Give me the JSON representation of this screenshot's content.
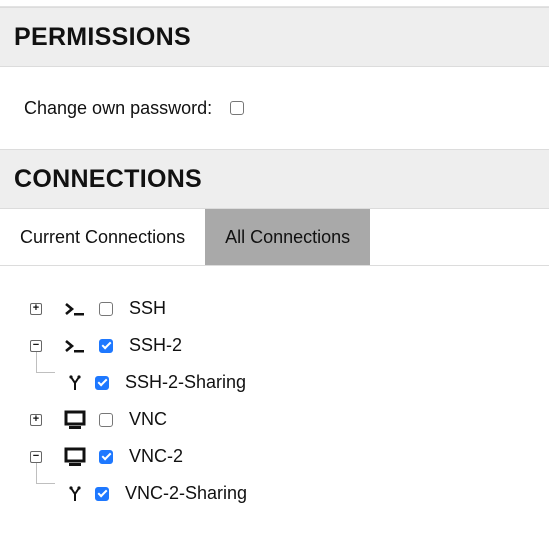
{
  "permissions": {
    "title": "PERMISSIONS",
    "change_password_label": "Change own password:",
    "change_password_checked": false
  },
  "connections": {
    "title": "CONNECTIONS",
    "tabs": [
      {
        "label": "Current Connections",
        "active": false
      },
      {
        "label": "All Connections",
        "active": true
      }
    ],
    "tree": [
      {
        "label": "SSH",
        "icon": "terminal-icon",
        "expander": "plus-expand-icon",
        "checked": false
      },
      {
        "label": "SSH-2",
        "icon": "terminal-icon",
        "expander": "minus-collapse-icon",
        "checked": true
      },
      {
        "label": "SSH-2-Sharing",
        "icon": "sharing-profile-icon",
        "checked": true
      },
      {
        "label": "VNC",
        "icon": "monitor-icon",
        "expander": "plus-expand-icon",
        "checked": false
      },
      {
        "label": "VNC-2",
        "icon": "monitor-icon",
        "expander": "minus-collapse-icon",
        "checked": true
      },
      {
        "label": "VNC-2-Sharing",
        "icon": "sharing-profile-icon",
        "checked": true
      }
    ]
  },
  "colors": {
    "checkbox_checked": "#1e78ff",
    "section_header_bg": "#eeeeee",
    "active_tab_bg": "#a9a9a9"
  }
}
